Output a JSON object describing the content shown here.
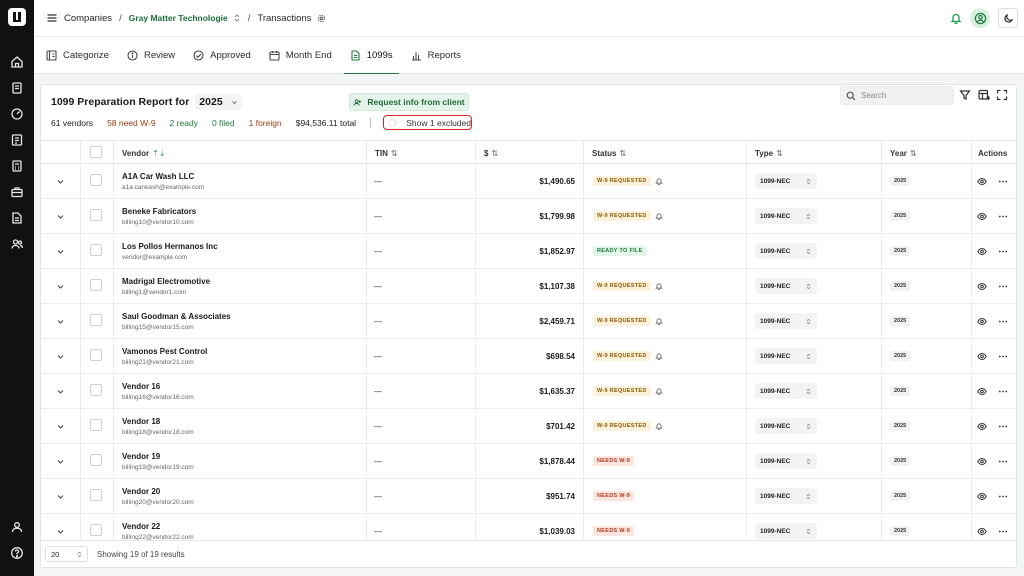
{
  "breadcrumb": {
    "companies": "Companies",
    "company": "Gray Matter Technologie",
    "page": "Transactions"
  },
  "tabs": [
    {
      "label": "Categorize",
      "icon": "categorize-icon"
    },
    {
      "label": "Review",
      "icon": "info-icon"
    },
    {
      "label": "Approved",
      "icon": "check-circle-icon"
    },
    {
      "label": "Month End",
      "icon": "calendar-icon"
    },
    {
      "label": "1099s",
      "icon": "document-icon",
      "active": true
    },
    {
      "label": "Reports",
      "icon": "bar-chart-icon"
    }
  ],
  "report": {
    "title": "1099 Preparation Report for",
    "year": "2025",
    "request_button": "Request info from client"
  },
  "summary": {
    "vendors": "61 vendors",
    "need_w9": "58 need W-9",
    "ready": "2 ready",
    "filed": "0 filed",
    "foreign": "1 foreign",
    "total": "$94,536.11 total",
    "excluded_toggle": "Show 1 excluded"
  },
  "search": {
    "placeholder": "Search"
  },
  "columns": {
    "vendor": "Vendor",
    "tin": "TIN",
    "amount": "$",
    "status": "Status",
    "type": "Type",
    "year": "Year",
    "actions": "Actions",
    "sort_symbol": "⇅",
    "vendor_sort_symbol": "⇡⇣"
  },
  "rows": [
    {
      "name": "A1A Car Wash LLC",
      "email": "a1a.carwash@example.com",
      "tin": "—",
      "amount": "$1,490.65",
      "status": "W-9 REQUESTED",
      "status_kind": "req",
      "type": "1099-NEC",
      "year": "2025"
    },
    {
      "name": "Beneke Fabricators",
      "email": "billing10@vendor10.com",
      "tin": "—",
      "amount": "$1,799.98",
      "status": "W-9 REQUESTED",
      "status_kind": "req",
      "type": "1099-NEC",
      "year": "2025"
    },
    {
      "name": "Los Pollos Hermanos Inc",
      "email": "vendor@example.com",
      "tin": "—",
      "amount": "$1,852.97",
      "status": "READY TO FILE",
      "status_kind": "ready",
      "type": "1099-NEC",
      "year": "2025"
    },
    {
      "name": "Madrigal Electromotive",
      "email": "billing1@vendor1.com",
      "tin": "—",
      "amount": "$1,107.38",
      "status": "W-9 REQUESTED",
      "status_kind": "req",
      "type": "1099-NEC",
      "year": "2025"
    },
    {
      "name": "Saul Goodman & Associates",
      "email": "billing15@vendor15.com",
      "tin": "—",
      "amount": "$2,459.71",
      "status": "W-9 REQUESTED",
      "status_kind": "req",
      "type": "1099-NEC",
      "year": "2025"
    },
    {
      "name": "Vamonos Pest Control",
      "email": "billing21@vendor21.com",
      "tin": "—",
      "amount": "$698.54",
      "status": "W-9 REQUESTED",
      "status_kind": "req",
      "type": "1099-NEC",
      "year": "2025"
    },
    {
      "name": "Vendor 16",
      "email": "billing16@vendor16.com",
      "tin": "—",
      "amount": "$1,635.37",
      "status": "W-9 REQUESTED",
      "status_kind": "req",
      "type": "1099-NEC",
      "year": "2025"
    },
    {
      "name": "Vendor 18",
      "email": "billing18@vendor18.com",
      "tin": "—",
      "amount": "$701.42",
      "status": "W-9 REQUESTED",
      "status_kind": "req",
      "type": "1099-NEC",
      "year": "2025"
    },
    {
      "name": "Vendor 19",
      "email": "billing19@vendor19.com",
      "tin": "—",
      "amount": "$1,878.44",
      "status": "NEEDS W-9",
      "status_kind": "need",
      "type": "1099-NEC",
      "year": "2025"
    },
    {
      "name": "Vendor 20",
      "email": "billing20@vendor20.com",
      "tin": "—",
      "amount": "$951.74",
      "status": "NEEDS W-9",
      "status_kind": "need",
      "type": "1099-NEC",
      "year": "2025"
    },
    {
      "name": "Vendor 22",
      "email": "billing22@vendor22.com",
      "tin": "—",
      "amount": "$1,039.03",
      "status": "NEEDS W-9",
      "status_kind": "need",
      "type": "1099-NEC",
      "year": "2025"
    }
  ],
  "footer": {
    "page_size": "20",
    "showing": "Showing 19 of 19 results"
  },
  "colors": {
    "accent": "#1e7a40",
    "need": "#b0361b",
    "requested": "#8a5a00",
    "highlight": "#dd2222"
  }
}
